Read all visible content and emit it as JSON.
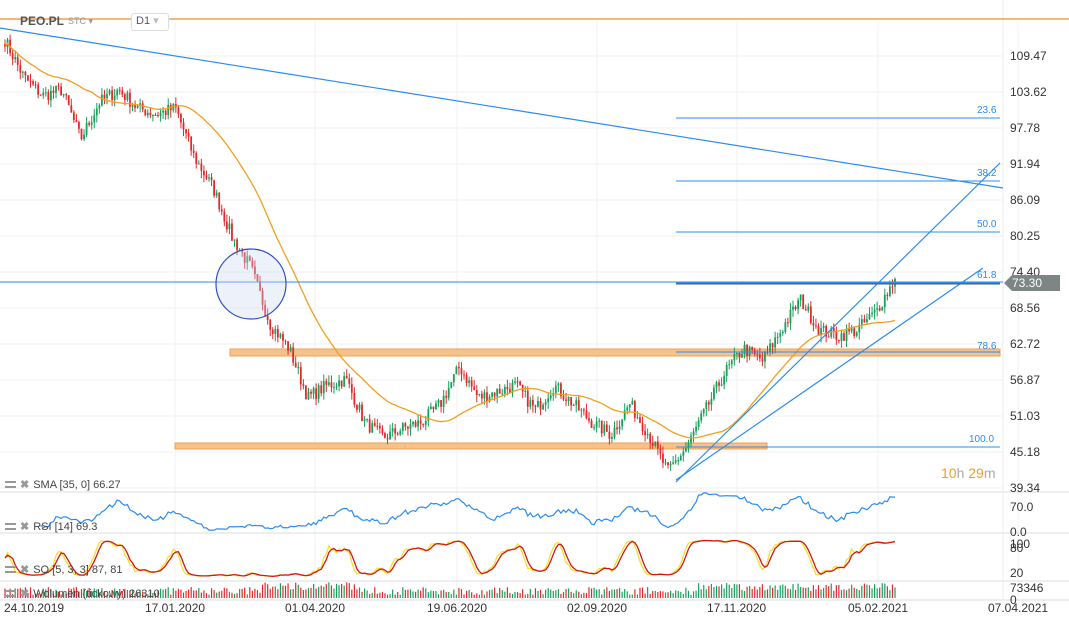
{
  "header": {
    "symbol": "PEO.PL",
    "type": "STC",
    "interval": "D1"
  },
  "price_axis": [
    "109.47",
    "103.62",
    "97.78",
    "91.94",
    "86.09",
    "80.25",
    "74.40",
    "68.56",
    "62.72",
    "56.87",
    "51.03",
    "45.18",
    "39.34"
  ],
  "current_price": "73.30",
  "timer": {
    "hours": "10",
    "h": "h",
    "minutes": "29",
    "m": "m"
  },
  "fib_levels": [
    "23.6",
    "38.2",
    "50.0",
    "61.8",
    "78.6",
    "100.0"
  ],
  "indicators": {
    "sma": "SMA  [35,  0]  66.27",
    "rsi": "RSI  [14]  69.3",
    "so": "SO  [5,  3,  3]  87,  81",
    "volume": "Wolumen  (tickowy)  26310"
  },
  "rsi_axis": [
    "70.0",
    "0.0"
  ],
  "so_axis": [
    "100",
    "80",
    "20"
  ],
  "volume_axis": [
    "73346",
    "0"
  ],
  "x_axis": [
    "24.10.2019",
    "17.01.2020",
    "01.04.2020",
    "19.06.2020",
    "02.09.2020",
    "17.11.2020",
    "05.02.2021",
    "07.04.2021"
  ],
  "colors": {
    "up": "#16a05a",
    "down": "#e02a2a",
    "sma": "#f0a020",
    "lines": "#2a8cf0",
    "zone": "#f7c28a"
  },
  "chart_data": {
    "type": "candlestick",
    "title": "PEO.PL D1",
    "ylim": [
      39.34,
      109.47
    ],
    "approx_close_path": [
      112,
      106,
      103,
      104,
      96,
      102,
      104,
      101,
      100,
      101,
      93,
      88,
      80,
      75,
      66,
      62,
      54,
      56,
      57,
      50,
      47.5,
      49,
      50,
      53,
      59,
      54,
      55,
      56,
      52,
      56,
      53,
      50,
      48,
      53,
      48,
      42,
      46,
      52,
      58,
      62,
      60,
      65,
      70,
      65,
      64,
      65,
      68,
      73.3
    ],
    "sma_period": 35,
    "sma_last": 66.27,
    "rsi_last": 69.3,
    "so_last": [
      87,
      81
    ],
    "volume_last": 26310
  }
}
